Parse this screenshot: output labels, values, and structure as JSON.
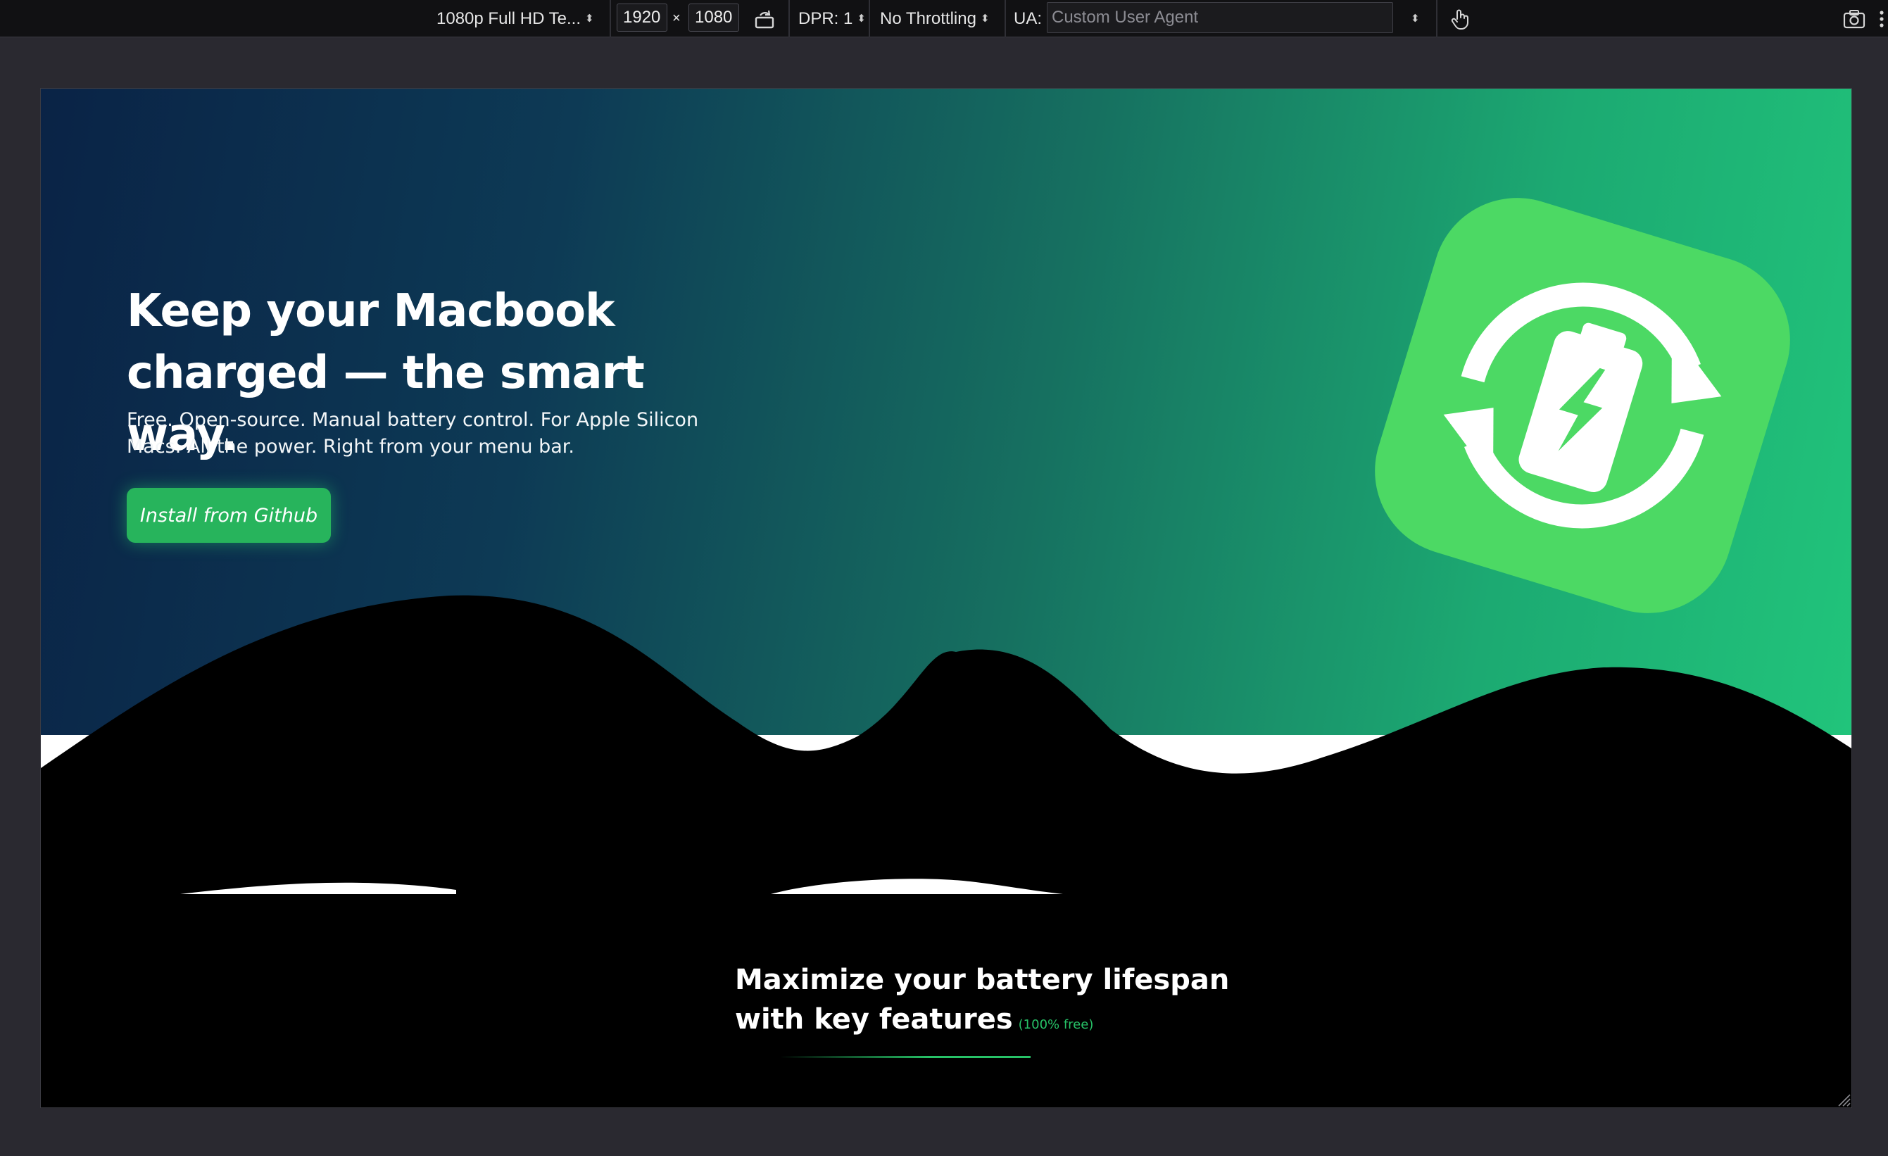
{
  "toolbar": {
    "device_label": "1080p Full HD Te...",
    "width_value": "1920",
    "times_sign": "×",
    "height_value": "1080",
    "dpr_label": "DPR: 1",
    "throttling_label": "No Throttling",
    "ua_label": "UA:",
    "ua_placeholder": "Custom User Agent",
    "icons": [
      "rotate-icon",
      "touch-icon",
      "screenshot-icon",
      "more-icon"
    ]
  },
  "hero": {
    "headline_line1": "Keep your Macbook",
    "headline_line2": "charged — the smart way.",
    "subtext": "Free. Open-source. Manual battery control. For Apple Silicon Macs. All the power. Right from your menu bar.",
    "install_button": "Install from Github",
    "app_icon": "battery-sync-icon"
  },
  "features": {
    "title_line1": "Maximize your battery lifespan",
    "title_line2": "with key features",
    "badge": "(100% free)"
  },
  "colors": {
    "gradient_start": "#0a2346",
    "gradient_end": "#21c47b",
    "accent_green": "#27b45c",
    "app_icon_green": "#4cd964",
    "toolbar_bg": "#111113",
    "page_bg": "#2a2930"
  }
}
